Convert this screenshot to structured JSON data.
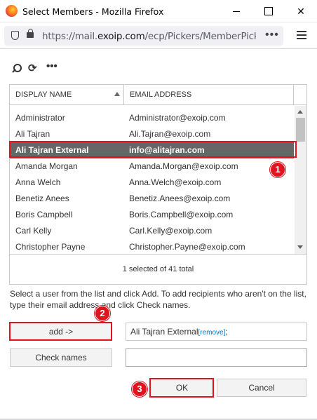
{
  "window": {
    "title": "Select Members - Mozilla Firefox",
    "url_prefix": "https://mail.",
    "url_domain": "exoip.com",
    "url_path": "/ecp/Pickers/MemberPicker.a",
    "url_more": "•••",
    "minimize_icon": "minimize-icon",
    "maximize_icon": "maximize-icon",
    "close_glyph": "✕"
  },
  "toolbar": {
    "refresh_glyph": "⟳",
    "more_glyph": "•••"
  },
  "list": {
    "columns": [
      "DISPLAY NAME",
      "EMAIL ADDRESS"
    ],
    "rows": [
      {
        "name": "Administrator",
        "email": "Administrator@exoip.com"
      },
      {
        "name": "Ali Tajran",
        "email": "Ali.Tajran@exoip.com"
      },
      {
        "name": "Ali Tajran External",
        "email": "info@alitajran.com",
        "selected": true
      },
      {
        "name": "Amanda Morgan",
        "email": "Amanda.Morgan@exoip.com"
      },
      {
        "name": "Anna Welch",
        "email": "Anna.Welch@exoip.com"
      },
      {
        "name": "Benetiz Anees",
        "email": "Benetiz.Anees@exoip.com"
      },
      {
        "name": "Boris Campbell",
        "email": "Boris.Campbell@exoip.com"
      },
      {
        "name": "Carl Kelly",
        "email": "Carl.Kelly@exoip.com"
      },
      {
        "name": "Christopher Payne",
        "email": "Christopher.Payne@exoip.com"
      }
    ],
    "status": "1 selected of 41 total"
  },
  "instructions": "Select a user from the list and click Add. To add recipients who aren't on the list, type their email address and click Check names.",
  "buttons": {
    "add": "add ->",
    "check_names": "Check names",
    "ok": "OK",
    "cancel": "Cancel"
  },
  "recipients": {
    "name": "Ali Tajran External",
    "remove_label": "[remove]",
    "separator": ";"
  },
  "check_names_value": "",
  "annotations": [
    "1",
    "2",
    "3"
  ],
  "colors": {
    "selected_row": "#666666",
    "highlight": "#e0141e",
    "link": "#0072c6"
  }
}
